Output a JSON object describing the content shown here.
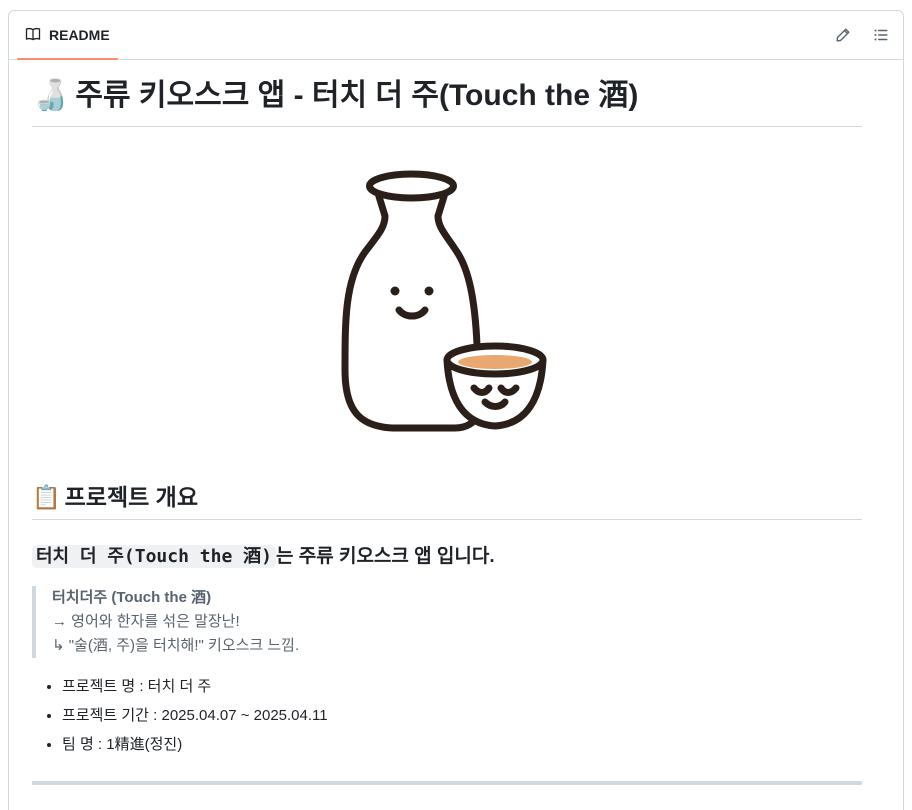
{
  "header": {
    "tab_label": "README",
    "accent_color": "#fd8c73",
    "edit_icon": "pencil-icon",
    "outline_icon": "list-unordered-icon"
  },
  "title": {
    "emoji": "🍶",
    "text": "주류 키오스크 앱 - 터치 더 주(Touch the 酒)"
  },
  "mascot": {
    "description_icon": "sake-bottle-and-cup-mascot",
    "cup_fill_color": "#e8a870",
    "line_color": "#2b1f1a"
  },
  "overview": {
    "emoji": "📋",
    "heading": "프로젝트 개요",
    "code_text": "터치 더 주(Touch the 酒)",
    "subhead_text": "는 주류 키오스크 앱 입니다.",
    "quote": {
      "title": "터치더주 (Touch the 酒)",
      "line1": "→ 영어와 한자를 섞은 말장난!",
      "line2": "↳ \"술(酒, 주)을 터치해!\" 키오스크 느낌."
    },
    "items": [
      "프로젝트 명 : 터치 더 주",
      "프로젝트 기간 : 2025.04.07 ~ 2025.04.11",
      "팀 명 : 1精進(정진)"
    ]
  }
}
